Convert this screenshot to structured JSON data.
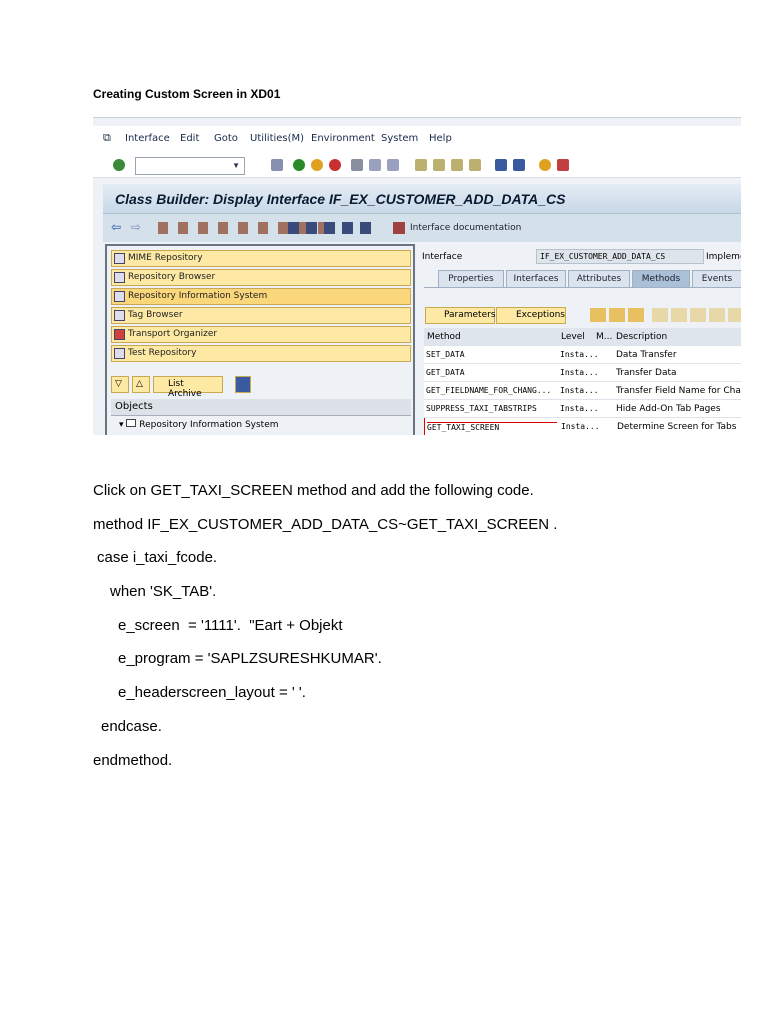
{
  "heading": "Creating Custom Screen in XD01",
  "sap": {
    "menu": [
      "Interface",
      "Edit",
      "Goto",
      "Utilities(M)",
      "Environment",
      "System",
      "Help"
    ],
    "title": "Class Builder: Display Interface IF_EX_CUSTOMER_ADD_DATA_CS",
    "interface_doc": "Interface documentation",
    "nav_buttons": [
      "MIME Repository",
      "Repository Browser",
      "Repository Information System",
      "Tag Browser",
      "Transport Organizer",
      "Test Repository"
    ],
    "list_archive": "List Archive",
    "objects_label": "Objects",
    "tree_item": "Repository Information System",
    "interface_label": "Interface",
    "interface_value": "IF_EX_CUSTOMER_ADD_DATA_CS",
    "impl_label": "Impleme",
    "tabs": [
      "Properties",
      "Interfaces",
      "Attributes",
      "Methods",
      "Events"
    ],
    "active_tab": "Methods",
    "parameters_btn": "Parameters",
    "exceptions_btn": "Exceptions",
    "columns": [
      "Method",
      "Level",
      "M...",
      "Description"
    ],
    "rows": [
      {
        "method": "SET_DATA",
        "level": "Insta...",
        "desc": "Data Transfer"
      },
      {
        "method": "GET_DATA",
        "level": "Insta...",
        "desc": "Transfer Data"
      },
      {
        "method": "GET_FIELDNAME_FOR_CHANG...",
        "level": "Insta...",
        "desc": "Transfer Field Name for Chan"
      },
      {
        "method": "SUPPRESS_TAXI_TABSTRIPS",
        "level": "Insta...",
        "desc": "Hide Add-On Tab Pages"
      },
      {
        "method": "GET_TAXI_SCREEN",
        "level": "Insta...",
        "desc": "Determine Screen for Tabs"
      }
    ]
  },
  "lines": [
    "Click on GET_TAXI_SCREEN method and add the following code.",
    "method IF_EX_CUSTOMER_ADD_DATA_CS~GET_TAXI_SCREEN .",
    "case i_taxi_fcode.",
    "when 'SK_TAB'.",
    "e_screen  = '1111'.  \"Eart + Objekt",
    "e_program = 'SAPLZSURESHKUMAR'.",
    "e_headerscreen_layout = ' '.",
    "endcase.",
    "endmethod."
  ]
}
